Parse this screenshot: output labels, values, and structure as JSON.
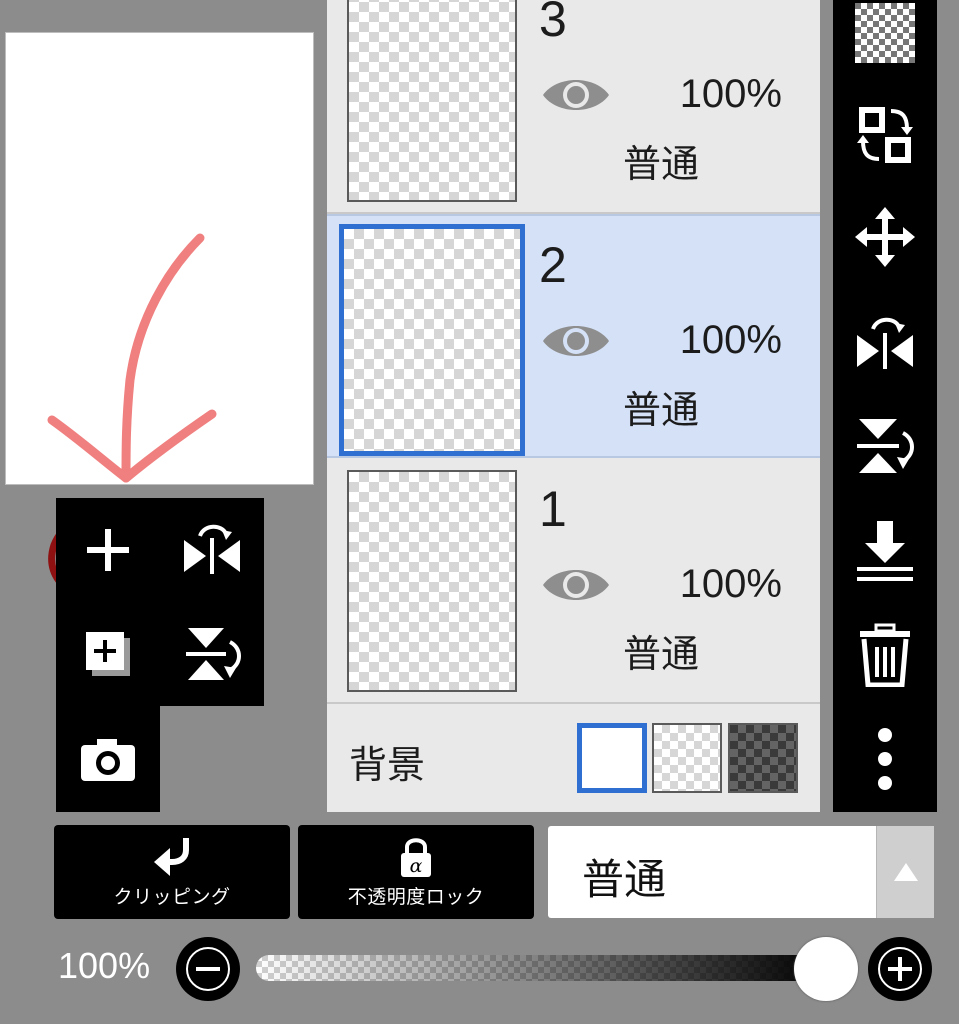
{
  "layers": [
    {
      "number": "3",
      "opacity": "100%",
      "blend": "普通",
      "selected": false
    },
    {
      "number": "2",
      "opacity": "100%",
      "blend": "普通",
      "selected": true
    },
    {
      "number": "1",
      "opacity": "100%",
      "blend": "普通",
      "selected": false
    }
  ],
  "background": {
    "label": "背景",
    "options": [
      "white",
      "transparent",
      "dark-checker"
    ],
    "selected": "white"
  },
  "bottom_buttons": {
    "clipping_label": "クリッピング",
    "alpha_lock_label": "不透明度ロック",
    "alpha_symbol": "α"
  },
  "blend_mode": {
    "value": "普通"
  },
  "opacity_slider": {
    "label": "100%",
    "value_percent": 100
  },
  "left_tools": [
    "add-layer-icon",
    "flip-horizontal-icon",
    "add-layer-copy-icon",
    "flip-vertical-icon",
    "camera-icon"
  ],
  "right_tools": [
    "checker-icon",
    "swap-layer-icon",
    "move-icon",
    "flip-horizontal-icon",
    "flip-vertical-icon",
    "merge-down-icon",
    "trash-icon",
    "more-icon"
  ],
  "colors": {
    "selection_blue": "#2f6fd1",
    "selected_row": "#d4e1f6",
    "annotation_red": "#f07f7f",
    "annotation_dark_red": "#8e1010"
  }
}
